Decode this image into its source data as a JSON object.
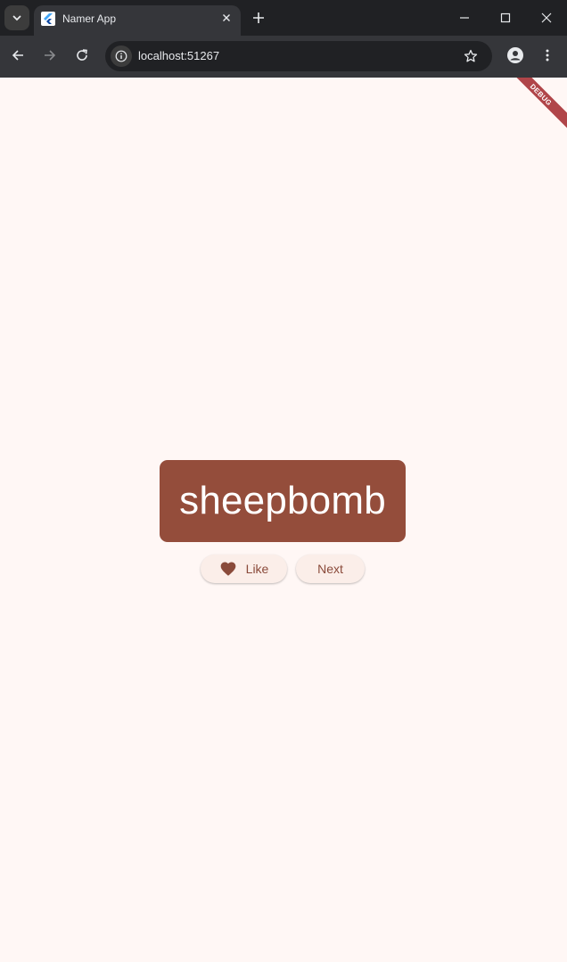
{
  "browser": {
    "tab_title": "Namer App",
    "url": "localhost:51267"
  },
  "app": {
    "debug_banner": "DEBUG",
    "current_word": "sheepbomb",
    "like_label": "Like",
    "next_label": "Next",
    "accent_color": "#944d3b",
    "background_color": "#fff7f5"
  }
}
